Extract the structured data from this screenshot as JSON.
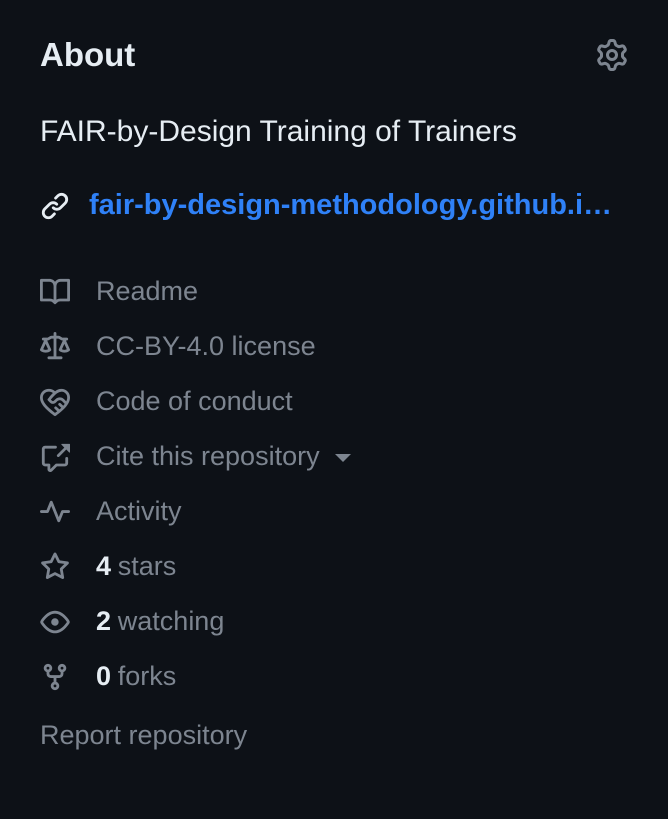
{
  "header": {
    "title": "About"
  },
  "description": "FAIR-by-Design Training of Trainers",
  "link": {
    "text": "fair-by-design-methodology.github.io/…"
  },
  "meta": {
    "readme": "Readme",
    "license": "CC-BY-4.0 license",
    "conduct": "Code of conduct",
    "cite": "Cite this repository",
    "activity": "Activity",
    "stars_count": "4",
    "stars_label": "stars",
    "watching_count": "2",
    "watching_label": "watching",
    "forks_count": "0",
    "forks_label": "forks"
  },
  "report": "Report repository"
}
